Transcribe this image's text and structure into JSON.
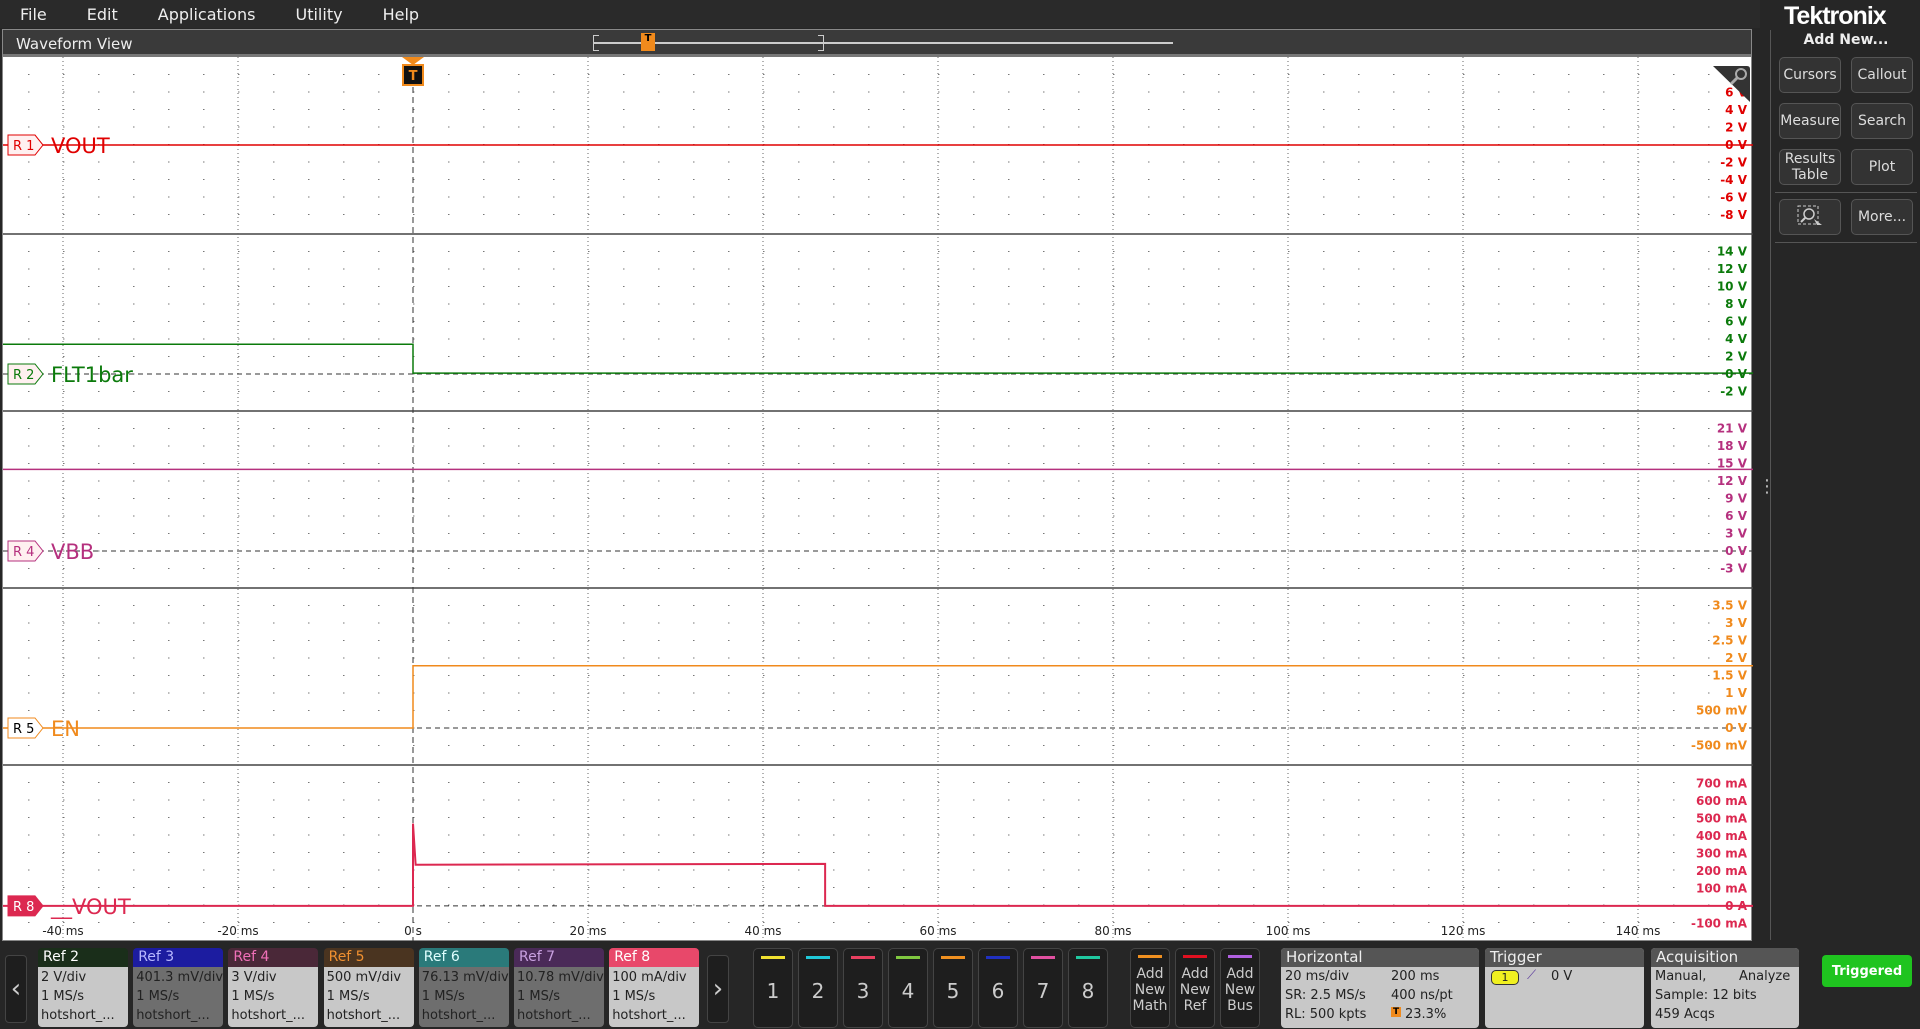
{
  "menu": [
    "File",
    "Edit",
    "Applications",
    "Utility",
    "Help"
  ],
  "brand": "Tektronix",
  "waveform_view": {
    "title": "Waveform View",
    "trigger_marker": "T"
  },
  "right_panel": {
    "title": "Add New...",
    "buttons": [
      "Cursors",
      "Callout",
      "Measure",
      "Search",
      "Results Table",
      "Plot",
      "More..."
    ]
  },
  "chart_data": {
    "type": "line",
    "xlabel": "time",
    "xlim": [
      -46.86,
      153.14
    ],
    "x_units": "ms",
    "x_ticks": [
      {
        "v": -40,
        "label": "-40 ms"
      },
      {
        "v": -20,
        "label": "-20 ms"
      },
      {
        "v": 0,
        "label": "0 s"
      },
      {
        "v": 20,
        "label": "20 ms"
      },
      {
        "v": 40,
        "label": "40 ms"
      },
      {
        "v": 60,
        "label": "60 ms"
      },
      {
        "v": 80,
        "label": "80 ms"
      },
      {
        "v": 100,
        "label": "100 ms"
      },
      {
        "v": 120,
        "label": "120 ms"
      },
      {
        "v": 140,
        "label": "140 ms"
      }
    ],
    "series": [
      {
        "badge": "R 1",
        "name": "VOUT",
        "color": "#e00000",
        "per_div": 2,
        "zero_div": 5.03,
        "badge_style": "outline",
        "points": [
          [
            -47,
            0
          ],
          [
            154,
            0
          ]
        ],
        "ticks": [
          {
            "v": 6,
            "label": "6 V"
          },
          {
            "v": 4,
            "label": "4 V"
          },
          {
            "v": 2,
            "label": "2 V"
          },
          {
            "v": 0,
            "label": "0 V"
          },
          {
            "v": -2,
            "label": "-2 V"
          },
          {
            "v": -4,
            "label": "-4 V"
          },
          {
            "v": -6,
            "label": "-6 V"
          },
          {
            "v": -8,
            "label": "-8 V"
          }
        ]
      },
      {
        "badge": "R 2",
        "name": "FLT1bar",
        "color": "#0b7a0b",
        "per_div": 2,
        "zero_div": 8,
        "badge_style": "outline",
        "points": [
          [
            -47,
            3.4
          ],
          [
            0,
            3.4
          ],
          [
            0,
            0.1
          ],
          [
            154,
            0.1
          ]
        ],
        "ticks": [
          {
            "v": 14,
            "label": "14 V"
          },
          {
            "v": 12,
            "label": "12 V"
          },
          {
            "v": 10,
            "label": "10 V"
          },
          {
            "v": 8,
            "label": "8 V"
          },
          {
            "v": 6,
            "label": "6 V"
          },
          {
            "v": 4,
            "label": "4 V"
          },
          {
            "v": 2,
            "label": "2 V"
          },
          {
            "v": 0,
            "label": "0 V"
          },
          {
            "v": -2,
            "label": "-2 V"
          }
        ]
      },
      {
        "badge": "R 4",
        "name": "VBB",
        "color": "#b5307e",
        "per_div": 3,
        "zero_div": 8,
        "badge_style": "outline",
        "points": [
          [
            -47,
            14
          ],
          [
            154,
            14
          ]
        ],
        "ticks": [
          {
            "v": 21,
            "label": "21 V"
          },
          {
            "v": 18,
            "label": "18 V"
          },
          {
            "v": 15,
            "label": "15 V"
          },
          {
            "v": 12,
            "label": "12 V"
          },
          {
            "v": 9,
            "label": "9 V"
          },
          {
            "v": 6,
            "label": "6 V"
          },
          {
            "v": 3,
            "label": "3 V"
          },
          {
            "v": 0,
            "label": "0 V"
          },
          {
            "v": -3,
            "label": "-3 V"
          }
        ]
      },
      {
        "badge": "R 5",
        "name": "EN",
        "color": "#f08a1c",
        "per_div": 0.5,
        "zero_div": 8,
        "badge_style": "plain",
        "points": [
          [
            -47,
            0
          ],
          [
            0,
            0
          ],
          [
            0,
            1.78
          ],
          [
            154,
            1.78
          ]
        ],
        "ticks": [
          {
            "v": 3.5,
            "label": "3.5 V"
          },
          {
            "v": 3,
            "label": "3 V"
          },
          {
            "v": 2.5,
            "label": "2.5 V"
          },
          {
            "v": 2,
            "label": "2 V"
          },
          {
            "v": 1.5,
            "label": "1.5 V"
          },
          {
            "v": 1,
            "label": "1 V"
          },
          {
            "v": 0.5,
            "label": "500 mV"
          },
          {
            "v": 0,
            "label": "0 V"
          },
          {
            "v": -0.5,
            "label": "-500 mV"
          }
        ]
      },
      {
        "badge": "R 8",
        "name": "__VOUT",
        "color": "#dc2850",
        "per_div": 100,
        "zero_div": 8.05,
        "badge_style": "filled",
        "points": [
          [
            -47,
            0
          ],
          [
            0,
            0
          ],
          [
            0,
            470
          ],
          [
            0.3,
            235
          ],
          [
            47.1,
            240
          ],
          [
            47.1,
            0
          ],
          [
            154,
            0
          ]
        ],
        "ticks": [
          {
            "v": 700,
            "label": "700 mA"
          },
          {
            "v": 600,
            "label": "600 mA"
          },
          {
            "v": 500,
            "label": "500 mA"
          },
          {
            "v": 400,
            "label": "400 mA"
          },
          {
            "v": 300,
            "label": "300 mA"
          },
          {
            "v": 200,
            "label": "200 mA"
          },
          {
            "v": 100,
            "label": "100 mA"
          },
          {
            "v": 0,
            "label": "0 A"
          },
          {
            "v": -100,
            "label": "-100 mA"
          }
        ]
      }
    ]
  },
  "refs": [
    {
      "label": "Ref 2",
      "scale": "2 V/div",
      "rate": "1 MS/s",
      "file": "hotshort_...",
      "head": "#1a2e1a",
      "fg": "#fff",
      "on": true
    },
    {
      "label": "Ref 3",
      "scale": "401.3 mV/div",
      "rate": "1 MS/s",
      "file": "hotshort_...",
      "head": "#1c1ca0",
      "fg": "#b8b8ff",
      "on": false
    },
    {
      "label": "Ref 4",
      "scale": "3 V/div",
      "rate": "1 MS/s",
      "file": "hotshort_...",
      "head": "#4a2838",
      "fg": "#f070b8",
      "on": true
    },
    {
      "label": "Ref 5",
      "scale": "500 mV/div",
      "rate": "1 MS/s",
      "file": "hotshort_...",
      "head": "#4a3420",
      "fg": "#f09030",
      "on": true
    },
    {
      "label": "Ref 6",
      "scale": "76.13 mV/div",
      "rate": "1 MS/s",
      "file": "hotshort_...",
      "head": "#2a7a7a",
      "fg": "#e0ffff",
      "on": false
    },
    {
      "label": "Ref 7",
      "scale": "10.78 mV/div",
      "rate": "1 MS/s",
      "file": "hotshort_...",
      "head": "#4a2a58",
      "fg": "#c8a0e0",
      "on": false
    },
    {
      "label": "Ref 8",
      "scale": "100 mA/div",
      "rate": "1 MS/s",
      "file": "hotshort_...",
      "head": "#e8486a",
      "fg": "#fff",
      "on": true
    }
  ],
  "channels": [
    {
      "n": "1",
      "color": "#f0e030"
    },
    {
      "n": "2",
      "color": "#20c8d8"
    },
    {
      "n": "3",
      "color": "#e84060"
    },
    {
      "n": "4",
      "color": "#80c840"
    },
    {
      "n": "5",
      "color": "#f09020"
    },
    {
      "n": "6",
      "color": "#2030c0"
    },
    {
      "n": "7",
      "color": "#e050a0"
    },
    {
      "n": "8",
      "color": "#20c8a0"
    }
  ],
  "add_new": [
    {
      "label": "Add New Math",
      "color": "#f09020"
    },
    {
      "label": "Add New Ref",
      "color": "#e01020"
    },
    {
      "label": "Add New Bus",
      "color": "#b060e0"
    }
  ],
  "horizontal": {
    "title": "Horizontal",
    "scale": "20 ms/div",
    "position": "200 ms",
    "sr": "SR: 2.5 MS/s",
    "pt": "400 ns/pt",
    "rl": "RL: 500 kpts",
    "trig_pos": "23.3%"
  },
  "trigger": {
    "title": "Trigger",
    "source": "1",
    "level": "0 V"
  },
  "acquisition": {
    "title": "Acquisition",
    "mode": "Manual,",
    "action": "Analyze",
    "sample": "Sample: 12 bits",
    "acqs": "459 Acqs"
  },
  "status": "Triggered"
}
